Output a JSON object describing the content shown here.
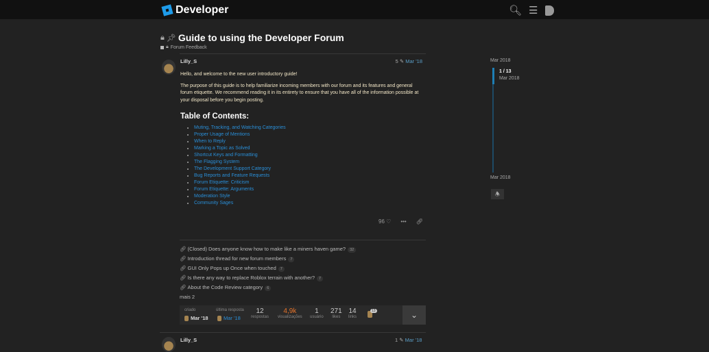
{
  "header": {
    "brand": "Developer"
  },
  "topic": {
    "title": "Guide to using the Developer Forum",
    "category": "Forum Feedback"
  },
  "post": {
    "author": "Lilly_S",
    "edits": "5",
    "date": "Mar '18",
    "intro": "Hello, and welcome to the new user introductory guide!",
    "purpose": "The purpose of this guide is to help familiarize incoming members with our forum and its features and general forum etiquette. We recommend reading it in its entirety to ensure that you have all of the information possible at your disposal before you begin posting.",
    "toc_heading": "Table of Contents:",
    "toc": [
      "Muting, Tracking, and Watching Categories",
      "Proper Usage of Mentions",
      "When to Reply",
      "Marking a Topic as Solved",
      "Shortcut Keys and Formatting",
      "The Flagging System",
      "The Development Support Category",
      "Bug Reports and Feature Requests",
      "Forum Etiquette: Criticism",
      "Forum Etiquette: Arguments",
      "Moderation Style",
      "Community Sages"
    ],
    "likes": "96"
  },
  "related": [
    {
      "title": "(Closed) Does anyone know how to make like a miners haven game?",
      "count": "32"
    },
    {
      "title": "Introduction thread for new forum members",
      "count": "7"
    },
    {
      "title": "GUI Only Pops up Once when touched",
      "count": "7"
    },
    {
      "title": "Is there any way to replace Roblox terrain with another?",
      "count": "7"
    },
    {
      "title": "About the Code Review category",
      "count": "6"
    }
  ],
  "more": "mais 2",
  "stats": {
    "created_label": "criado",
    "created": "Mar '18",
    "last_label": "última resposta",
    "last": "Mar '18",
    "replies": "12",
    "replies_label": "respostas",
    "views": "4,9k",
    "views_label": "visualizações",
    "users": "1",
    "users_label": "usuário",
    "likes": "271",
    "likes_label": "likes",
    "links": "14",
    "links_label": "links",
    "participant_count": "13"
  },
  "next_post": {
    "author": "Lilly_S",
    "edits": "1",
    "date": "Mar '18"
  },
  "timeline": {
    "start": "Mar 2018",
    "position": "1 / 13",
    "position_date": "Mar 2018",
    "end": "Mar 2018"
  },
  "colors": {
    "accent": "#1e9be9",
    "views": "#e8742a"
  }
}
